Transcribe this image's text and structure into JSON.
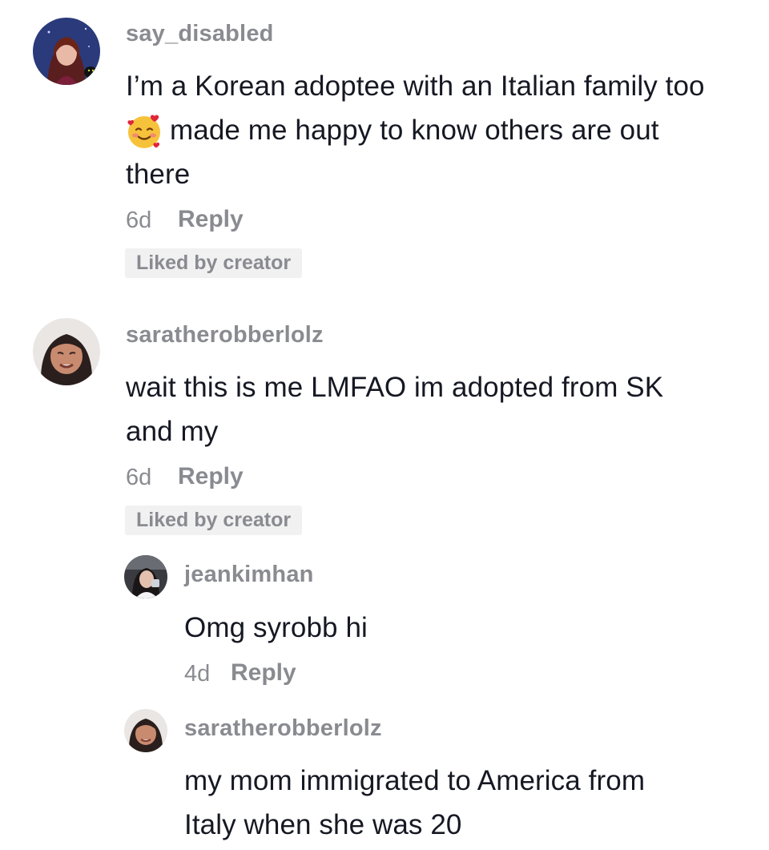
{
  "comments": [
    {
      "username": "say_disabled",
      "text_lines": [
        "I’m a Korean adoptee with an Italian family too",
        "made me happy to know others are out",
        "there"
      ],
      "emoji": "smiling-face-with-hearts",
      "time": "6d",
      "reply_label": "Reply",
      "badge": "Liked by creator"
    },
    {
      "username": "saratherobberlolz",
      "text_lines": [
        "wait this is me LMFAO im adopted from SK",
        "and my"
      ],
      "time": "6d",
      "reply_label": "Reply",
      "badge": "Liked by creator"
    }
  ],
  "replies": [
    {
      "username": "jeankimhan",
      "text_lines": [
        "Omg syrobb hi"
      ],
      "time": "4d",
      "reply_label": "Reply"
    },
    {
      "username": "saratherobberlolz",
      "text_lines": [
        "my mom immigrated to America from",
        "Italy when she was 20"
      ]
    }
  ],
  "colors": {
    "text": "#161823",
    "muted": "#8a8b91",
    "badge_bg": "#f1f1f2"
  }
}
